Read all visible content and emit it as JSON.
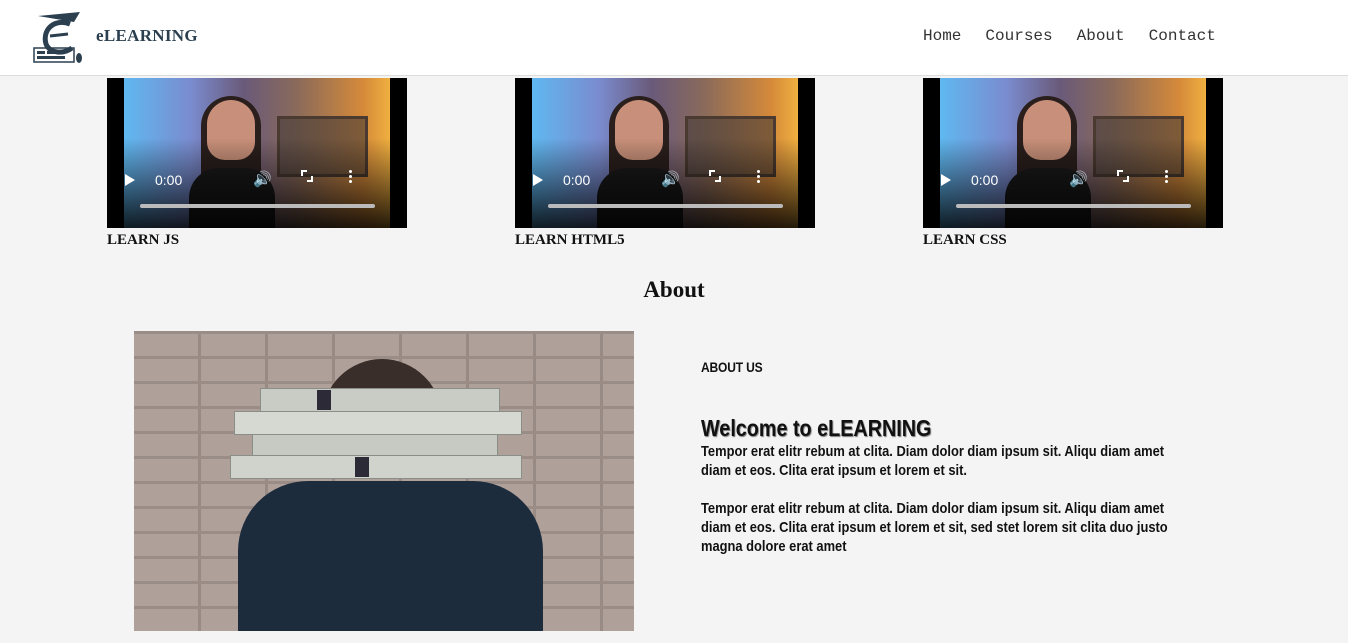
{
  "header": {
    "brand": "eLEARNING",
    "nav": [
      "Home",
      "Courses",
      "About",
      "Contact"
    ]
  },
  "courses": [
    {
      "title": "LEARN JS",
      "time": "0:00"
    },
    {
      "title": "LEARN HTML5",
      "time": "0:00"
    },
    {
      "title": "LEARN CSS",
      "time": "0:00"
    }
  ],
  "about": {
    "heading": "About",
    "label": "ABOUT US",
    "welcome": "Welcome to eLEARNING",
    "para1": "Tempor erat elitr rebum at clita. Diam dolor diam ipsum sit. Aliqu diam amet diam et eos. Clita erat ipsum et lorem et sit.",
    "para2": "Tempor erat elitr rebum at clita. Diam dolor diam ipsum sit. Aliqu diam amet diam et eos. Clita erat ipsum et lorem et sit, sed stet lorem sit clita duo justo magna dolore erat amet"
  },
  "colors": {
    "page_bg": "#f4f4f4",
    "brand": "#2b3f4f"
  }
}
